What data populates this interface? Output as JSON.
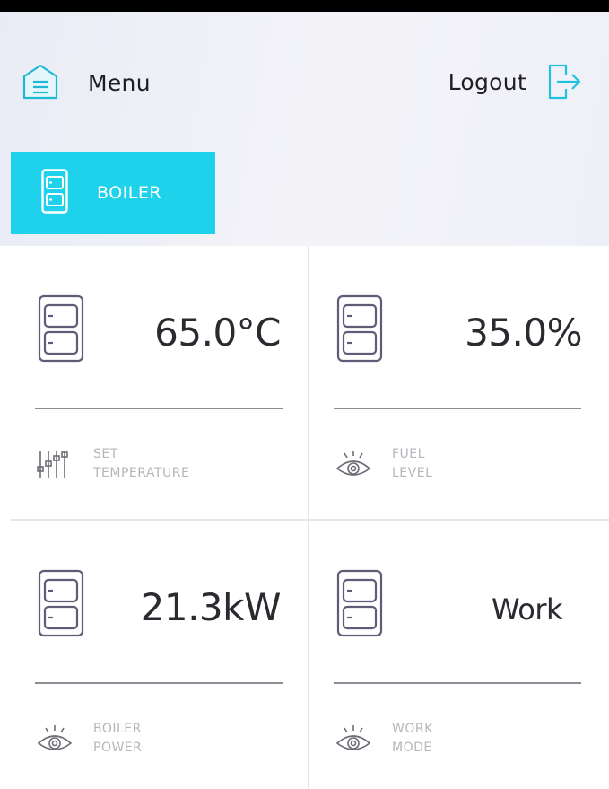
{
  "header": {
    "menu_label": "Menu",
    "menu_icon": "home-menu-icon",
    "logout_label": "Logout",
    "logout_icon": "logout-icon"
  },
  "tabs": [
    {
      "label": "BOILER",
      "icon": "boiler-icon",
      "active": true
    }
  ],
  "colors": {
    "accent": "#1fd2ec",
    "text_dark": "#2a2a30",
    "caption": "#b6b6bc",
    "divider": "#8d8d95"
  },
  "tiles": [
    {
      "value": "65.0°C",
      "caption": "SET\nTEMPERATURE",
      "caption_icon": "sliders-icon"
    },
    {
      "value": "35.0%",
      "caption": "FUEL\nLEVEL",
      "caption_icon": "eye-icon"
    },
    {
      "value": "21.3kW",
      "caption": "BOILER\nPOWER",
      "caption_icon": "eye-icon"
    },
    {
      "value": "Work",
      "caption": "WORK\nMODE",
      "caption_icon": "eye-icon"
    }
  ]
}
